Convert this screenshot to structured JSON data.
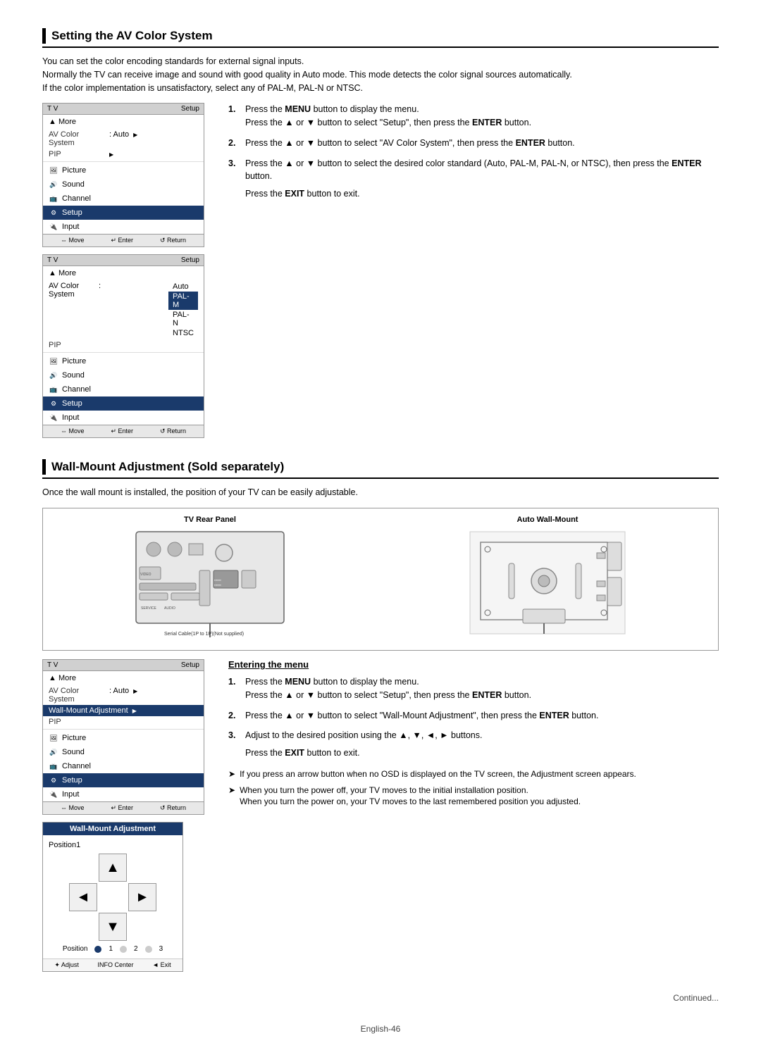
{
  "sections": {
    "av_color": {
      "title": "Setting the AV Color System",
      "desc1": "You can set the color encoding standards for external signal inputs.",
      "desc2": "Normally the TV can receive image and sound with good quality in Auto mode. This mode detects the color signal sources automatically.",
      "desc3": "If the color implementation is unsatisfactory, select any of PAL-M, PAL-N or NTSC.",
      "steps": [
        {
          "num": "1.",
          "text1": "Press the ",
          "bold1": "MENU",
          "text2": " button to display the menu.",
          "text3": "Press the ▲ or ▼ button to select \"Setup\", then press the ",
          "bold2": "ENTER",
          "text4": " button."
        },
        {
          "num": "2.",
          "text1": "Press the ▲ or ▼ button to select \"AV Color System\", then press the ",
          "bold1": "ENTER",
          "text2": " button."
        },
        {
          "num": "3.",
          "text1": "Press the ▲ or ▼ button to select the desired color standard (Auto, PAL-M, PAL-N, or NTSC), then press the ",
          "bold1": "ENTER",
          "text2": " button.",
          "text3": "Press the ",
          "bold2": "EXIT",
          "text4": " button to exit."
        }
      ],
      "menu1": {
        "tv_label": "T V",
        "setup_label": "Setup",
        "more_label": "▲ More",
        "av_label": "AV Color System",
        "av_value": ": Auto",
        "pip_label": "PIP",
        "items": [
          "Picture",
          "Sound",
          "Channel",
          "Setup",
          "Input"
        ],
        "footer": [
          "⇔ Move",
          "↵ Enter",
          "↺ Return"
        ]
      },
      "menu2": {
        "tv_label": "T V",
        "setup_label": "Setup",
        "more_label": "▲ More",
        "av_label": "AV Color System",
        "pip_label": "PIP",
        "options": [
          "Auto",
          "PAL-M",
          "PAL-N",
          "NTSC"
        ],
        "selected_option": "PAL-M",
        "items": [
          "Picture",
          "Sound",
          "Channel",
          "Setup",
          "Input"
        ],
        "footer": [
          "⇔ Move",
          "↵ Enter",
          "↺ Return"
        ]
      }
    },
    "wall_mount": {
      "title": "Wall-Mount Adjustment (Sold separately)",
      "desc": "Once the wall mount is installed, the position of your TV can be easily adjustable.",
      "diagram": {
        "rear_panel_title": "TV Rear Panel",
        "wall_mount_title": "Auto Wall-Mount",
        "cable_label": "Serial Cable(1P to 1P)(Not supplied)"
      },
      "entering_menu_title": "Entering the menu",
      "steps": [
        {
          "num": "1.",
          "text1": "Press the ",
          "bold1": "MENU",
          "text2": " button to display the menu.",
          "text3": "Press the ▲ or ▼ button to select \"Setup\", then press the ",
          "bold2": "ENTER",
          "text4": " button."
        },
        {
          "num": "2.",
          "text1": "Press the ▲ or ▼ button to select \"Wall-Mount Adjustment\", then press the ",
          "bold1": "ENTER",
          "text2": " button."
        },
        {
          "num": "3.",
          "text1": "Adjust to the desired position using the ▲, ▼, ◄, ► buttons.",
          "text2": "Press the ",
          "bold2": "EXIT",
          "text3": " button to exit."
        }
      ],
      "notes": [
        "If you press an arrow button when no OSD is displayed on the TV screen, the Adjustment screen appears.",
        "When you turn the power off, your TV moves to the initial installation position. When you turn the power on, your TV moves to the last remembered position you adjusted."
      ],
      "menu1": {
        "tv_label": "T V",
        "setup_label": "Setup",
        "more_label": "▲ More",
        "av_label": "AV Color System",
        "av_value": ": Auto",
        "wall_label": "Wall-Mount Adjustment",
        "pip_label": "PIP",
        "items": [
          "Picture",
          "Sound",
          "Channel",
          "Setup",
          "Input"
        ],
        "footer": [
          "⇔ Move",
          "↵ Enter",
          "↺ Return"
        ]
      },
      "adj_menu": {
        "title": "Wall-Mount Adjustment",
        "position_label": "Position1",
        "pos_labels": [
          "Position",
          "1",
          "2",
          "3"
        ],
        "footer": [
          "✦ Adjust",
          "INFO Center",
          "◄ Exit"
        ]
      }
    }
  },
  "footer": {
    "page": "English-46",
    "continued": "Continued..."
  }
}
